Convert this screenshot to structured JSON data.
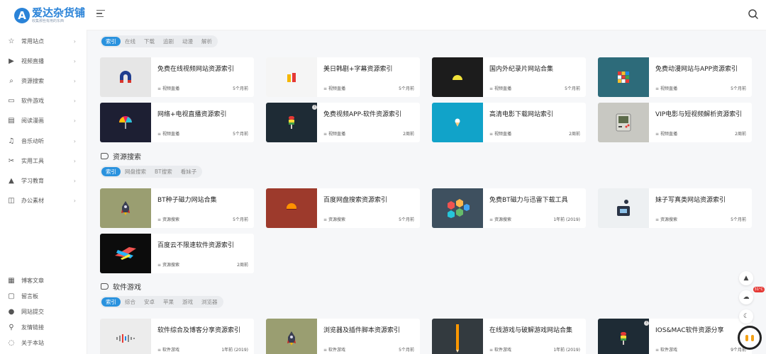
{
  "brand": {
    "title": "爱达杂货铺",
    "subtitle": "收集那些有用的东西",
    "logo_letter": "A",
    "color": "#2a83d8"
  },
  "sidebar": {
    "items": [
      {
        "label": "常用站点",
        "icon": "star-icon",
        "g": "☆"
      },
      {
        "label": "视频直播",
        "icon": "play-icon",
        "g": "▶"
      },
      {
        "label": "资源搜索",
        "icon": "search-icon",
        "g": "⌕"
      },
      {
        "label": "软件游戏",
        "icon": "monitor-icon",
        "g": "▭"
      },
      {
        "label": "阅读漫画",
        "icon": "book-icon",
        "g": "▤"
      },
      {
        "label": "音乐动听",
        "icon": "music-icon",
        "g": "♫"
      },
      {
        "label": "实用工具",
        "icon": "tools-icon",
        "g": "✂"
      },
      {
        "label": "学习教育",
        "icon": "graduation-icon",
        "g": "▲"
      },
      {
        "label": "办公素材",
        "icon": "briefcase-icon",
        "g": "◫"
      }
    ],
    "bottom": [
      {
        "label": "博客文章",
        "icon": "article-icon",
        "g": "▦"
      },
      {
        "label": "留言板",
        "icon": "message-icon",
        "g": "▢"
      },
      {
        "label": "网站提交",
        "icon": "upload-icon",
        "g": "●"
      },
      {
        "label": "友情链接",
        "icon": "link-icon",
        "g": "⚲"
      },
      {
        "label": "关于本站",
        "icon": "info-icon",
        "g": "◌"
      }
    ]
  },
  "sections": [
    {
      "key": "video",
      "title": "",
      "tabs": [
        "索引",
        "在线",
        "下载",
        "追剧",
        "动漫",
        "解析"
      ],
      "cards": [
        {
          "title": "免费在线视频网站资源索引",
          "cat": "视频直播",
          "time": "5个月前",
          "bg": "#e6e6e6",
          "glyph": "magnet"
        },
        {
          "title": "美日韩剧+字幕资源索引",
          "cat": "视频直播",
          "time": "5个月前",
          "bg": "#f5f5f5",
          "glyph": "bars"
        },
        {
          "title": "国内外纪录片网站合集",
          "cat": "视频直播",
          "time": "5个月前",
          "bg": "#1c1c1c",
          "glyph": "sun"
        },
        {
          "title": "免费动漫网站与APP资源索引",
          "cat": "视频直播",
          "time": "5个月前",
          "bg": "#2d6b7a",
          "glyph": "cube"
        },
        {
          "title": "网络+电视直播资源索引",
          "cat": "视频直播",
          "time": "5个月前",
          "bg": "#1d1f33",
          "glyph": "umbrella"
        },
        {
          "title": "免费视频APP-软件资源索引",
          "cat": "视频直播",
          "time": "2周前",
          "bg": "#1e2b35",
          "glyph": "popsicle",
          "badge": true
        },
        {
          "title": "高清电影下载网站索引",
          "cat": "视频直播",
          "time": "2周前",
          "bg": "#11a3c9",
          "glyph": "icecream"
        },
        {
          "title": "VIP电影与短视频解析资源索引",
          "cat": "视频直播",
          "time": "2周前",
          "bg": "#c8c8c2",
          "glyph": "gameboy"
        }
      ]
    },
    {
      "key": "search",
      "title": "资源搜索",
      "tabs": [
        "索引",
        "网盘搜索",
        "BT搜索",
        "看妹子"
      ],
      "cards": [
        {
          "title": "BT种子磁力网站合集",
          "cat": "资源搜索",
          "time": "5个月前",
          "bg": "#9a9e71",
          "glyph": "rocket"
        },
        {
          "title": "百度网盘搜索资源索引",
          "cat": "资源搜索",
          "time": "5个月前",
          "bg": "#9d3a2c",
          "glyph": "sunset"
        },
        {
          "title": "免费BT磁力与迅雷下载工具",
          "cat": "资源搜索",
          "time": "1年前 (2019)",
          "bg": "#3e505f",
          "glyph": "hex"
        },
        {
          "title": "妹子写真类网站资源索引",
          "cat": "资源搜索",
          "time": "5个月前",
          "bg": "#edf0f2",
          "glyph": "ink"
        },
        {
          "title": "百度云不限速软件资源索引",
          "cat": "资源搜索",
          "time": "2周前",
          "bg": "#0c0c0c",
          "glyph": "plane"
        }
      ]
    },
    {
      "key": "software",
      "title": "软件游戏",
      "tabs": [
        "索引",
        "综合",
        "安卓",
        "苹果",
        "游戏",
        "浏览器"
      ],
      "cards": [
        {
          "title": "软件综合及博客分享资源索引",
          "cat": "软件游戏",
          "time": "1年前 (2019)",
          "bg": "#ececec",
          "glyph": "wave"
        },
        {
          "title": "浏览器及插件脚本资源索引",
          "cat": "软件游戏",
          "time": "5个月前",
          "bg": "#9a9e71",
          "glyph": "rocket"
        },
        {
          "title": "在线游戏与破解游戏网站合集",
          "cat": "软件游戏",
          "time": "1年前 (2019)",
          "bg": "#333a3f",
          "glyph": "pencil"
        },
        {
          "title": "IOS&MAC软件资源分享",
          "cat": "软件游戏",
          "time": "9个月前",
          "bg": "#1e2b35",
          "glyph": "popsicle",
          "badge": true
        }
      ]
    }
  ],
  "floating": {
    "temperature": "31°C"
  }
}
